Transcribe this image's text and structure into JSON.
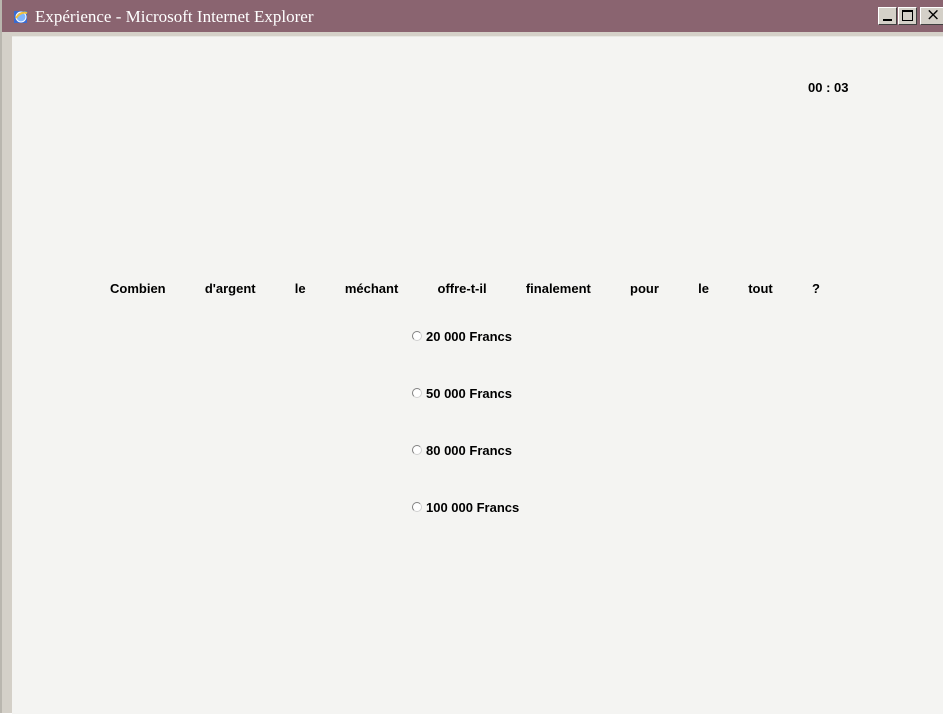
{
  "window": {
    "title": "Expérience - Microsoft Internet Explorer",
    "close_glyph": "×"
  },
  "timer": "00 : 03",
  "question": {
    "words": [
      "Combien",
      "d'argent",
      "le",
      "méchant",
      "offre-t-il",
      "finalement",
      "pour",
      "le",
      "tout",
      "?"
    ]
  },
  "options": [
    {
      "label": "20 000 Francs",
      "selected": false
    },
    {
      "label": "50 000 Francs",
      "selected": false
    },
    {
      "label": "80 000 Francs",
      "selected": false
    },
    {
      "label": "100 000 Francs",
      "selected": false
    }
  ],
  "colors": {
    "titlebar": "#8a6470",
    "content_bg": "#f4f4f2"
  },
  "icons": {
    "app": "internet-explorer-icon"
  }
}
